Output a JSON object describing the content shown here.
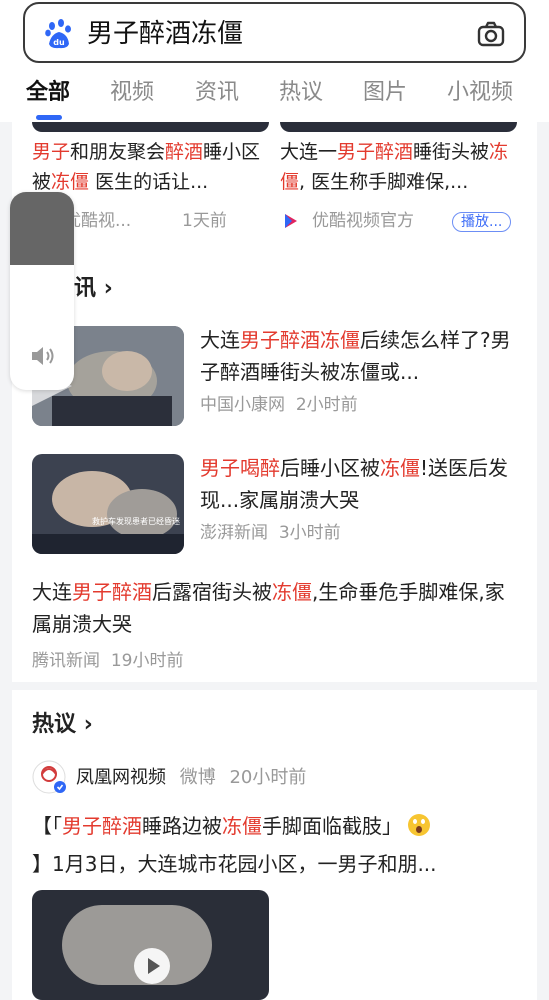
{
  "search": {
    "query": "男子醉酒冻僵"
  },
  "tabs": [
    "全部",
    "视频",
    "资讯",
    "热议",
    "图片",
    "小视频"
  ],
  "videos": [
    {
      "title_parts": [
        "男子",
        "和朋友聚会",
        "醉酒",
        "睡小区被",
        "冻僵",
        " 医生的话让..."
      ],
      "source": "优酷视...",
      "time": "1天前"
    },
    {
      "title_parts": [
        "大连一",
        "男子醉酒",
        "睡街头被",
        "冻僵",
        ", 医生称手脚难保,..."
      ],
      "source": "优酷视频官方",
      "badge": "播放..."
    }
  ],
  "news_section": {
    "label": "讯"
  },
  "news": [
    {
      "title_parts": [
        "大连",
        "男子醉酒冻僵",
        "后续怎么样了?男子醉酒睡街头被冻僵或..."
      ],
      "source": "中国小康网",
      "time": "2小时前"
    },
    {
      "title_parts": [
        "男子喝醉",
        "后睡小区被",
        "冻僵",
        "!送医后发现...家属崩溃大哭"
      ],
      "source": "澎湃新闻",
      "time": "3小时前",
      "thumb_caption": "救护车发现患者已经昏迷"
    },
    {
      "title_parts": [
        "大连",
        "男子醉酒",
        "后露宿街头被",
        "冻僵",
        ",生命垂危手脚难保,家属崩溃大哭"
      ],
      "source": "腾讯新闻",
      "time": "19小时前"
    }
  ],
  "hot_section": {
    "label": "热议"
  },
  "hot_post": {
    "author": "凤凰网视频",
    "platform": "微博",
    "time": "20小时前",
    "title_parts": [
      "【「",
      "男子醉酒",
      "睡路边被",
      "冻僵",
      "手脚面临截肢」"
    ],
    "body": "】1月3日，大连城市花园小区，一男子和朋..."
  },
  "colors": {
    "accent_red": "#e33a2e",
    "accent_blue": "#2f67f6"
  }
}
